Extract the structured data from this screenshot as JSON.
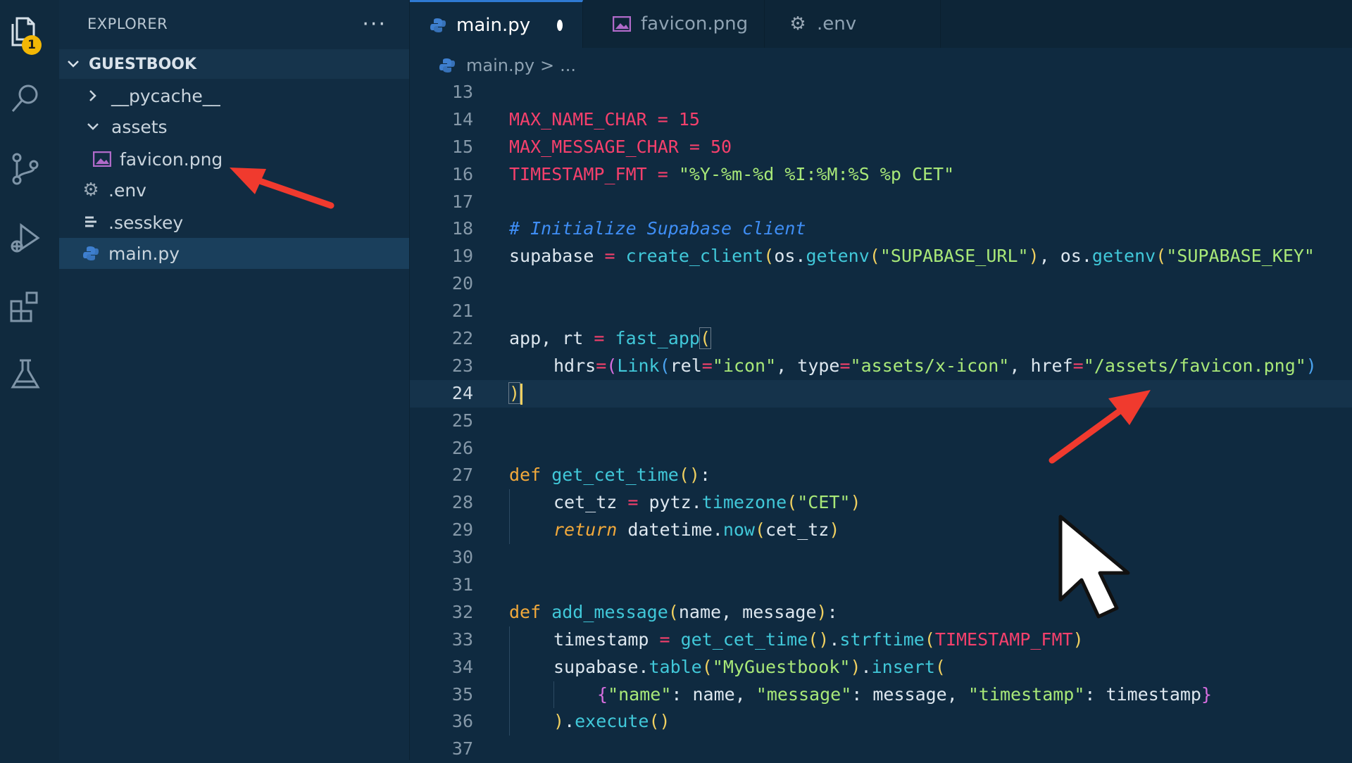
{
  "activity_bar": {
    "items": [
      {
        "name": "explorer-icon"
      },
      {
        "name": "search-icon"
      },
      {
        "name": "source-control-icon"
      },
      {
        "name": "run-debug-icon"
      },
      {
        "name": "extensions-icon"
      },
      {
        "name": "testing-icon"
      }
    ],
    "explorer_badge": "1"
  },
  "sidebar": {
    "title": "EXPLORER",
    "more": "···",
    "folder": "GUESTBOOK",
    "items": [
      {
        "label": "__pycache__",
        "type": "folder",
        "expanded": false
      },
      {
        "label": "assets",
        "type": "folder",
        "expanded": true
      },
      {
        "label": "favicon.png",
        "type": "image"
      },
      {
        "label": ".env",
        "type": "config"
      },
      {
        "label": ".sesskey",
        "type": "text"
      },
      {
        "label": "main.py",
        "type": "python",
        "selected": true
      }
    ]
  },
  "tabs": [
    {
      "label": "main.py",
      "icon": "python-icon",
      "active": true,
      "modified": true
    },
    {
      "label": "favicon.png",
      "icon": "image-icon",
      "active": false
    },
    {
      "label": ".env",
      "icon": "gear-icon",
      "active": false
    }
  ],
  "breadcrumb": {
    "file": "main.py",
    "separator": ">",
    "rest": "..."
  },
  "editor": {
    "current_line": "24",
    "line_numbers": [
      "13",
      "14",
      "15",
      "16",
      "17",
      "18",
      "19",
      "20",
      "21",
      "22",
      "23",
      "24",
      "25",
      "26",
      "27",
      "28",
      "29",
      "30",
      "31",
      "32",
      "33",
      "34",
      "35",
      "36",
      "37"
    ],
    "code": {
      "l14_name": "MAX_NAME_CHAR",
      "l14_eq": " = ",
      "l14_val": "15",
      "l15_name": "MAX_MESSAGE_CHAR",
      "l15_eq": " = ",
      "l15_val": "50",
      "l16_name": "TIMESTAMP_FMT",
      "l16_eq": " = ",
      "l16_val": "\"%Y-%m-%d %I:%M:%S %p CET\"",
      "l18_comment": "# Initialize Supabase client",
      "l19_a": "supabase",
      "l19_eq": " = ",
      "l19_fn": "create_client",
      "l19_p1": "(",
      "l19_os1": "os.",
      "l19_get1": "getenv",
      "l19_p2": "(",
      "l19_s1": "\"SUPABASE_URL\"",
      "l19_p3": ")",
      "l19_comma": ", ",
      "l19_os2": "os.",
      "l19_get2": "getenv",
      "l19_p4": "(",
      "l19_s2": "\"SUPABASE_KEY\"",
      "l22_a": "app, rt",
      "l22_eq": " = ",
      "l22_fn": "fast_app",
      "l22_p": "(",
      "l23_hdrs": "hdrs",
      "l23_eq": "=",
      "l23_p1": "(",
      "l23_link": "Link",
      "l23_p2": "(",
      "l23_rel": "rel",
      "l23_eq2": "=",
      "l23_icon": "\"icon\"",
      "l23_c1": ", ",
      "l23_type": "type",
      "l23_eq3": "=",
      "l23_tval": "\"assets/x-icon\"",
      "l23_c2": ", ",
      "l23_href": "href",
      "l23_eq4": "=",
      "l23_hval": "\"/assets/favicon.png\"",
      "l23_p3": ")",
      "l24_p": ")",
      "l27_def": "def",
      "l27_name": " get_cet_time",
      "l27_p": "()",
      "l27_colon": ":",
      "l28_a": "cet_tz",
      "l28_eq": " = ",
      "l28_mod": "pytz.",
      "l28_fn": "timezone",
      "l28_p1": "(",
      "l28_s": "\"CET\"",
      "l28_p2": ")",
      "l29_ret": "return",
      "l29_a": " datetime.",
      "l29_fn": "now",
      "l29_p1": "(",
      "l29_arg": "cet_tz",
      "l29_p2": ")",
      "l32_def": "def",
      "l32_name": " add_message",
      "l32_p1": "(",
      "l32_args": "name, message",
      "l32_p2": ")",
      "l32_colon": ":",
      "l33_a": "timestamp",
      "l33_eq": " = ",
      "l33_fn": "get_cet_time",
      "l33_p1": "()",
      "l33_dot": ".",
      "l33_fn2": "strftime",
      "l33_p2": "(",
      "l33_const": "TIMESTAMP_FMT",
      "l33_p3": ")",
      "l34_a": "supabase.",
      "l34_fn": "table",
      "l34_p1": "(",
      "l34_s": "\"MyGuestbook\"",
      "l34_p2": ")",
      "l34_dot": ".",
      "l34_fn2": "insert",
      "l34_p3": "(",
      "l35_b1": "{",
      "l35_k1": "\"name\"",
      "l35_c1": ": name, ",
      "l35_k2": "\"message\"",
      "l35_c2": ": message, ",
      "l35_k3": "\"timestamp\"",
      "l35_c3": ": timestamp",
      "l35_b2": "}",
      "l36_p1": ")",
      "l36_dot": ".",
      "l36_fn": "execute",
      "l36_p2": "()"
    }
  },
  "colors": {
    "keyword": "#f2a93b",
    "constant": "#f5406c",
    "string": "#a8e878",
    "comment": "#3f8ef5",
    "function": "#41c8d9",
    "bracket": "#f0d060",
    "annotation_arrow": "#f03a2e"
  },
  "annotations": [
    {
      "name": "red-arrow-to-favicon-file"
    },
    {
      "name": "red-arrow-to-favicon-href"
    }
  ]
}
